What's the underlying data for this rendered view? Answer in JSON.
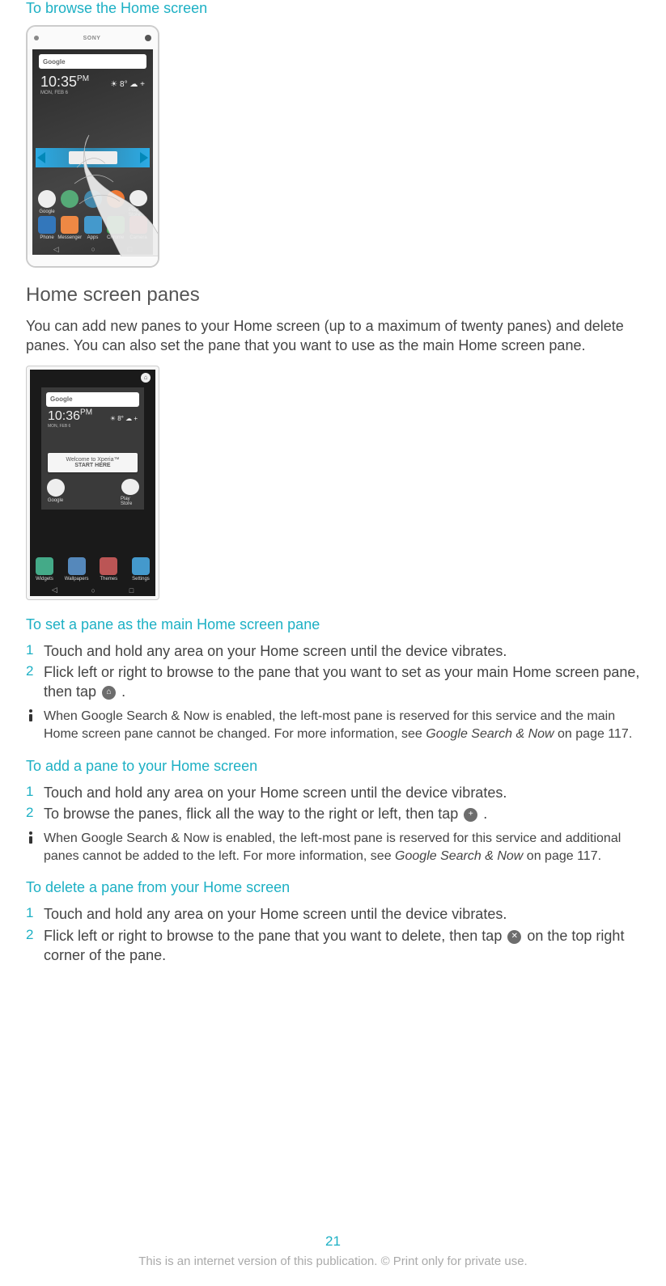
{
  "heading_browse": "To browse the Home screen",
  "phone": {
    "brand": "SONY",
    "search_label": "Google",
    "time1": "10:35",
    "time1_sup": "PM",
    "date_label": "MON, FEB 6",
    "weather": "☀ 8°   ☁ +",
    "time2": "10:36",
    "welcome_line1": "Welcome to Xperia™",
    "welcome_line2": "START HERE",
    "row1_labels": [
      "Google",
      "",
      "",
      "",
      "Play Store"
    ],
    "row2_labels_a": [
      "Phone",
      "Messenger",
      "Apps",
      "Chrome",
      "Camera"
    ],
    "row2_labels_b": [
      "Widgets",
      "Wallpapers",
      "Themes",
      "Settings"
    ]
  },
  "section_panes": {
    "heading": "Home screen panes",
    "intro": "You can add new panes to your Home screen (up to a maximum of twenty panes) and delete panes. You can also set the pane that you want to use as the main Home screen pane."
  },
  "set_pane": {
    "heading": "To set a pane as the main Home screen pane",
    "steps": [
      "Touch and hold any area on your Home screen until the device vibrates.",
      "Flick left or right to browse to the pane that you want to set as your main Home screen pane, then tap "
    ],
    "step2_tail": " .",
    "note_a": "When Google Search & Now is enabled, the left-most pane is reserved for this service and the main Home screen pane cannot be changed. For more information, see ",
    "note_ref": "Google Search & Now",
    "note_b": " on page 117."
  },
  "add_pane": {
    "heading": "To add a pane to your Home screen",
    "steps": [
      "Touch and hold any area on your Home screen until the device vibrates.",
      "To browse the panes, flick all the way to the right or left, then tap "
    ],
    "step2_tail": ".",
    "note_a": "When Google Search & Now is enabled, the left-most pane is reserved for this service and additional panes cannot be added to the left. For more information, see ",
    "note_ref": "Google Search & Now",
    "note_b": " on page 117."
  },
  "delete_pane": {
    "heading": "To delete a pane from your Home screen",
    "steps_a": "Touch and hold any area on your Home screen until the device vibrates.",
    "steps_b_pre": "Flick left or right to browse to the pane that you want to delete, then tap ",
    "steps_b_post": " on the top right corner of the pane."
  },
  "footer": {
    "page": "21",
    "copy": "This is an internet version of this publication. © Print only for private use."
  },
  "icons": {
    "home_glyph": "⌂",
    "plus_glyph": "+",
    "x_glyph": "✕"
  }
}
